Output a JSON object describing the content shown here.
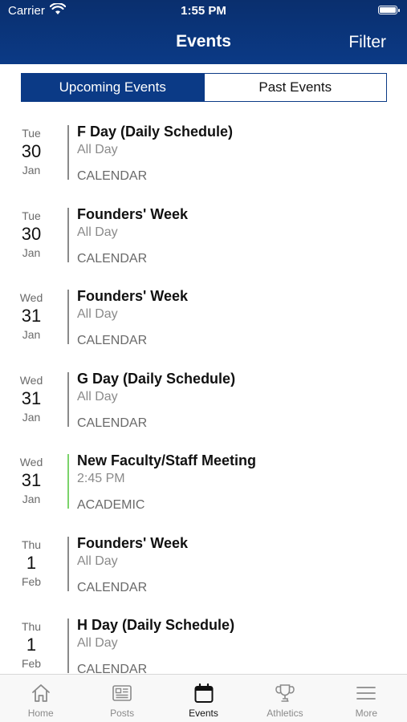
{
  "status_bar": {
    "carrier": "Carrier",
    "time": "1:55 PM"
  },
  "nav": {
    "title": "Events",
    "filter_label": "Filter"
  },
  "segments": {
    "upcoming": "Upcoming Events",
    "past": "Past Events",
    "selected": "Upcoming Events"
  },
  "events": [
    {
      "dow": "Tue",
      "day": "30",
      "mon": "Jan",
      "title": "F Day (Daily Schedule)",
      "time": "All Day",
      "category": "CALENDAR",
      "bar_color": "#8a8a8a"
    },
    {
      "dow": "Tue",
      "day": "30",
      "mon": "Jan",
      "title": "Founders' Week",
      "time": "All Day",
      "category": "CALENDAR",
      "bar_color": "#8a8a8a"
    },
    {
      "dow": "Wed",
      "day": "31",
      "mon": "Jan",
      "title": "Founders' Week",
      "time": "All Day",
      "category": "CALENDAR",
      "bar_color": "#8a8a8a"
    },
    {
      "dow": "Wed",
      "day": "31",
      "mon": "Jan",
      "title": "G Day (Daily Schedule)",
      "time": "All Day",
      "category": "CALENDAR",
      "bar_color": "#8a8a8a"
    },
    {
      "dow": "Wed",
      "day": "31",
      "mon": "Jan",
      "title": "New Faculty/Staff Meeting",
      "time": "2:45 PM",
      "category": "ACADEMIC",
      "bar_color": "#7bd36a"
    },
    {
      "dow": "Thu",
      "day": "1",
      "mon": "Feb",
      "title": "Founders' Week",
      "time": "All Day",
      "category": "CALENDAR",
      "bar_color": "#8a8a8a"
    },
    {
      "dow": "Thu",
      "day": "1",
      "mon": "Feb",
      "title": "H Day (Daily Schedule)",
      "time": "All Day",
      "category": "CALENDAR",
      "bar_color": "#8a8a8a"
    }
  ],
  "tabs": [
    {
      "label": "Home",
      "icon": "home-icon",
      "active": false
    },
    {
      "label": "Posts",
      "icon": "newspaper-icon",
      "active": false
    },
    {
      "label": "Events",
      "icon": "calendar-icon",
      "active": true
    },
    {
      "label": "Athletics",
      "icon": "trophy-icon",
      "active": false
    },
    {
      "label": "More",
      "icon": "menu-icon",
      "active": false
    }
  ],
  "colors": {
    "header": "#0b3a86",
    "accent": "#0b3a86",
    "academic": "#7bd36a",
    "calendar": "#8a8a8a"
  }
}
